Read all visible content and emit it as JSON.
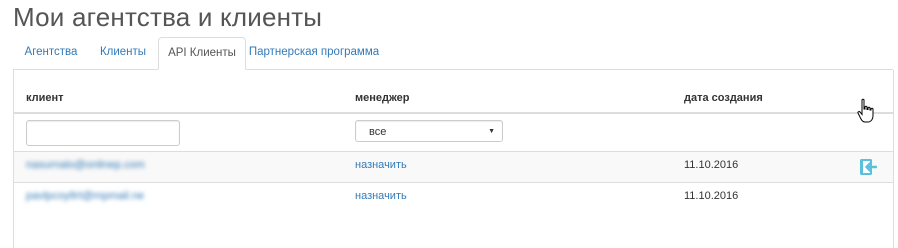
{
  "page": {
    "title": "Мои агентства и клиенты"
  },
  "tabs": [
    {
      "label": "Агентства",
      "active": false
    },
    {
      "label": "Клиенты",
      "active": false
    },
    {
      "label": "API Клиенты",
      "active": true
    },
    {
      "label": "Партнерская программа",
      "active": false
    }
  ],
  "table": {
    "columns": {
      "client": "клиент",
      "manager": "менеджер",
      "created": "дата создания"
    },
    "filters": {
      "client_value": "",
      "manager_selected": "все"
    },
    "rows": [
      {
        "client": "nasurnalo@onlinep.com",
        "manager_action": "назначить",
        "created": "11.10.2016"
      },
      {
        "client": "pavlpcoy8rt@mpmail.ne",
        "manager_action": "назначить",
        "created": "11.10.2016"
      }
    ]
  },
  "icons": {
    "row_action": "login-arrow-icon",
    "cursor": "hand-pointer-icon"
  },
  "colors": {
    "link": "#337ab7",
    "icon": "#5bc0de"
  }
}
